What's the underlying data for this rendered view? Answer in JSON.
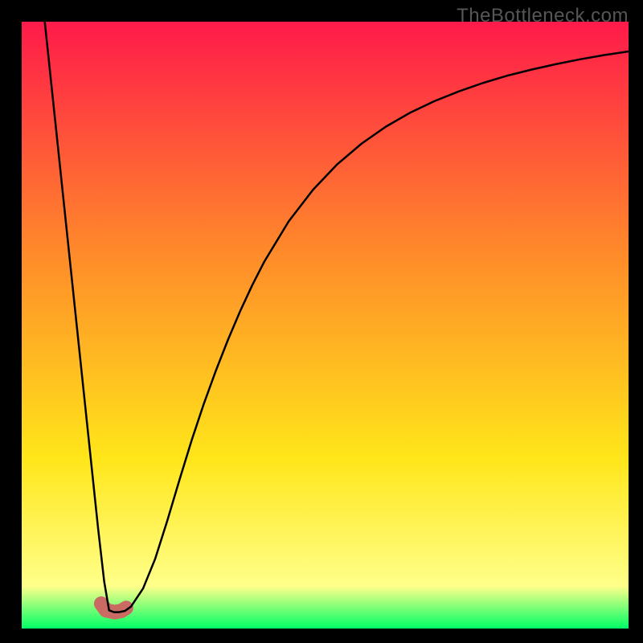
{
  "watermark": "TheBottleneck.com",
  "chart_data": {
    "type": "line",
    "title": "",
    "xlabel": "",
    "ylabel": "",
    "xlim": [
      0,
      100
    ],
    "ylim": [
      0,
      100
    ],
    "grid": false,
    "legend": false,
    "background_gradient": {
      "top": "#ff1a4a",
      "mid1": "#ff8a2a",
      "mid2": "#ffe61a",
      "bottom": "#00ff66"
    },
    "series": [
      {
        "name": "bottleneck-curve",
        "stroke": "#000000",
        "stroke_width": 2.5,
        "x": [
          3.8,
          5,
          6,
          7,
          8,
          9,
          10,
          11,
          12,
          12.6,
          13.6,
          14.4,
          15.2,
          16,
          17,
          18,
          20,
          22,
          24,
          26,
          28,
          30,
          32,
          34,
          36,
          38,
          40,
          44,
          48,
          52,
          56,
          60,
          64,
          68,
          72,
          76,
          80,
          84,
          88,
          92,
          96,
          100
        ],
        "y": [
          100,
          88.6,
          79.1,
          69.6,
          60.1,
          50.6,
          41.1,
          31.6,
          22.1,
          16.4,
          7.7,
          3.0,
          2.7,
          2.7,
          2.9,
          3.6,
          6.6,
          11.5,
          17.8,
          24.5,
          31.0,
          37.0,
          42.5,
          47.6,
          52.3,
          56.6,
          60.5,
          67.1,
          72.3,
          76.5,
          79.9,
          82.7,
          85.0,
          86.9,
          88.5,
          89.9,
          91.1,
          92.1,
          93.0,
          93.8,
          94.5,
          95.1
        ]
      },
      {
        "name": "minimum-marker",
        "type": "blob",
        "fill": "#c96a63",
        "points": [
          {
            "x": 13.1,
            "y": 4.1
          },
          {
            "x": 13.9,
            "y": 3.0
          },
          {
            "x": 15.3,
            "y": 2.7
          },
          {
            "x": 16.4,
            "y": 2.9
          },
          {
            "x": 17.2,
            "y": 3.4
          }
        ]
      }
    ]
  }
}
